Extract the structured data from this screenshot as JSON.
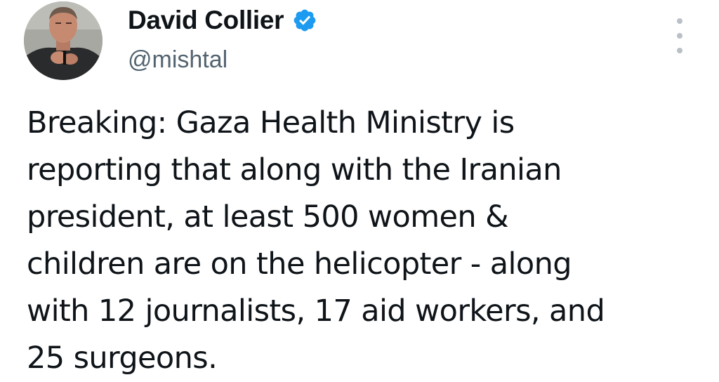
{
  "tweet": {
    "author": {
      "display_name": "David Collier",
      "handle": "@mishtal",
      "verified": true,
      "avatar_icon": "avatar"
    },
    "more_icon": "more-options-icon",
    "text_lines": [
      "Breaking: Gaza Health Ministry is",
      "reporting that along with the Iranian",
      "president, at least 500 women &",
      "children are on the helicopter - along",
      "with 12 journalists, 17 aid workers, and",
      "25 surgeons."
    ]
  },
  "colors": {
    "text": "#0f1419",
    "secondary_text": "#536471",
    "verified_badge": "#1d9bf0",
    "background": "#ffffff"
  }
}
